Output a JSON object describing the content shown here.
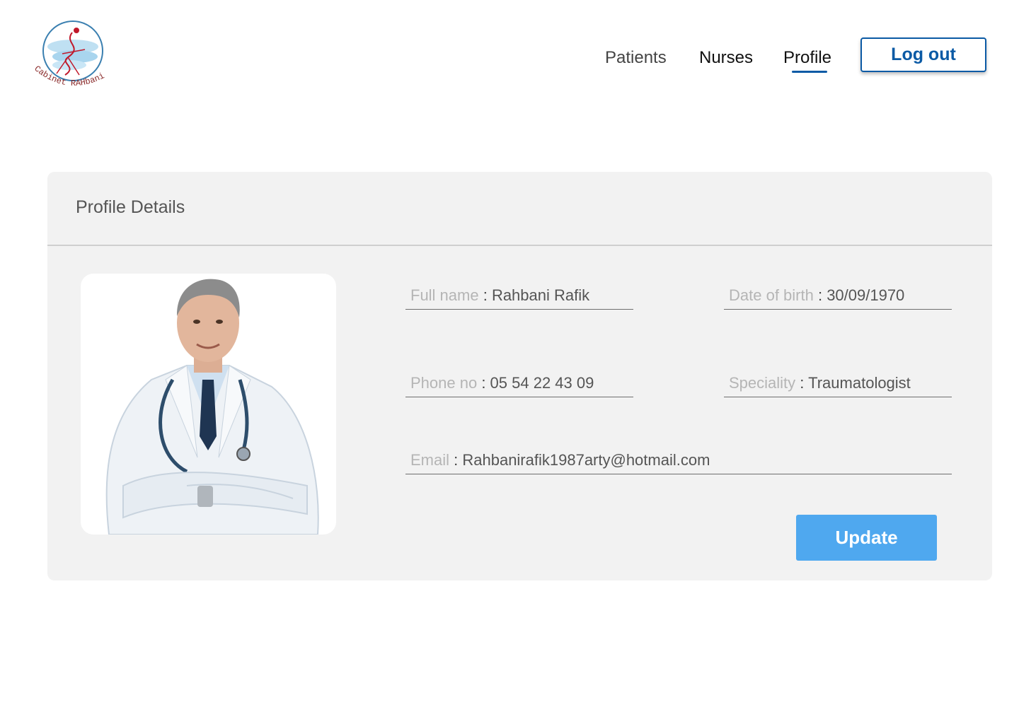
{
  "logo": {
    "text": "Cabinet RAHbani"
  },
  "nav": {
    "patients": "Patients",
    "nurses": "Nurses",
    "profile": "Profile",
    "logout": "Log out"
  },
  "card": {
    "title": "Profile Details",
    "fields": {
      "full_name": {
        "label": "Full name",
        "sep": " : ",
        "value": "Rahbani Rafik"
      },
      "dob": {
        "label": "Date of birth",
        "sep": " : ",
        "value": "30/09/1970"
      },
      "phone": {
        "label": "Phone no",
        "sep": " : ",
        "value": "05 54 22 43 09"
      },
      "speciality": {
        "label": "Speciality",
        "sep": " : ",
        "value": "Traumatologist"
      },
      "email": {
        "label": "Email",
        "sep": " : ",
        "value": "Rahbanirafik1987arty@hotmail.com"
      }
    },
    "update_label": "Update"
  },
  "colors": {
    "accent": "#0b5aa5",
    "update_button": "#4fa8ef",
    "card_bg": "#f2f2f2"
  },
  "icons": {
    "logo": "cabinet-logo-icon",
    "photo": "doctor-photo"
  }
}
